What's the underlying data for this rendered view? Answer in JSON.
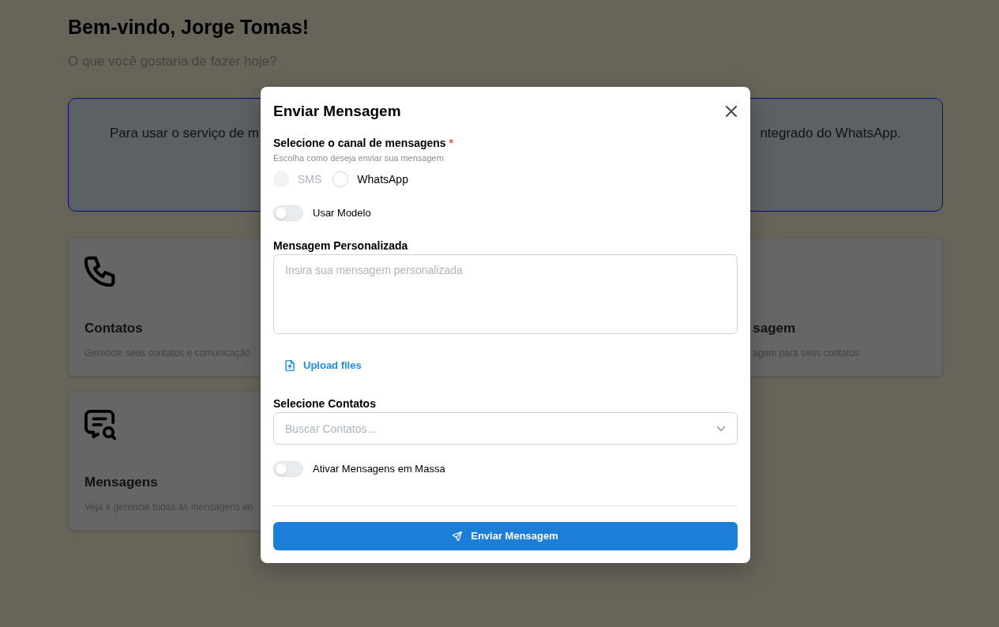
{
  "page": {
    "greeting": "Bem-vindo, Jorge Tomas!",
    "subtitle": "O que você gostaria de fazer hoje?"
  },
  "notice": {
    "text_parts": [
      "Para usar o serviço de m",
      "ntegrado do WhatsApp."
    ]
  },
  "cards": [
    {
      "title": "Contatos",
      "description": "Gerencie seus contatos e comunicação"
    },
    {
      "title": "sagem",
      "description": "agem para seus contatos"
    },
    {
      "title": "Mensagens",
      "description": "Veja e gerencie todas as mensagens en"
    }
  ],
  "modal": {
    "title": "Enviar Mensagem",
    "channel": {
      "label": "Selecione o canal de mensagens",
      "required_mark": "*",
      "hint": "Escolha como deseja enviar sua mensagem",
      "options": [
        {
          "label": "SMS",
          "selected": false,
          "disabled": true
        },
        {
          "label": "WhatsApp",
          "selected": false,
          "disabled": false
        }
      ]
    },
    "use_template": {
      "label": "Usar Modelo",
      "on": false
    },
    "message": {
      "label": "Mensagem Personalizada",
      "placeholder": "Insira sua mensagem personalizada"
    },
    "upload": {
      "label": "Upload files"
    },
    "contacts": {
      "label": "Selecione Contatos",
      "placeholder": "Buscar Contatos..."
    },
    "bulk": {
      "label": "Ativar Mensagens em Massa",
      "on": false
    },
    "submit": {
      "label": "Enviar Mensagem"
    }
  }
}
